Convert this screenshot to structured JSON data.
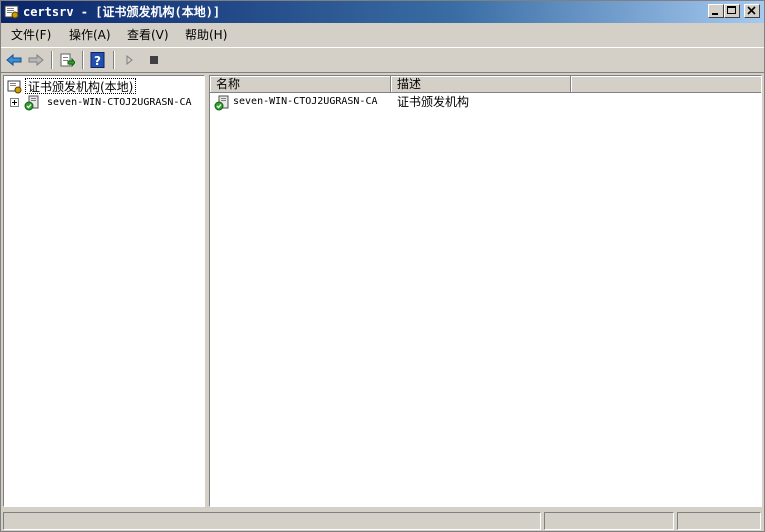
{
  "window": {
    "title": "certsrv - [证书颁发机构(本地)]",
    "icon": "certsrv-app-icon"
  },
  "menu": [
    {
      "label": "文件(F)"
    },
    {
      "label": "操作(A)"
    },
    {
      "label": "查看(V)"
    },
    {
      "label": "帮助(H)"
    }
  ],
  "toolbar": {
    "buttons": [
      "back-arrow-icon",
      "forward-arrow-icon",
      "export-list-icon",
      "help-icon",
      "play-icon",
      "stop-icon"
    ]
  },
  "tree": {
    "root_label": "证书颁发机构(本地)",
    "child_label": "seven-WIN-CTOJ2UGRASN-CA"
  },
  "list": {
    "columns": [
      "名称",
      "描述"
    ],
    "rows": [
      {
        "name": "seven-WIN-CTOJ2UGRASN-CA",
        "description": "证书颁发机构"
      }
    ]
  },
  "status": {
    "panel1": "",
    "panel2": "",
    "panel3": ""
  },
  "colors": {
    "titlebar_start": "#0a246a",
    "titlebar_end": "#a6caf0",
    "face": "#d4d0c8"
  }
}
